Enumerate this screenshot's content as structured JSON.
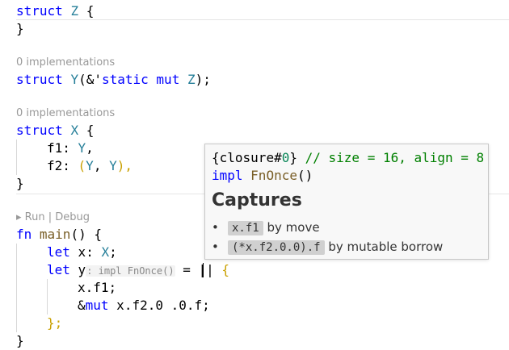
{
  "editor": {
    "lines": {
      "l1": {
        "kw": "struct",
        "name": "Z",
        "brace": "{"
      },
      "l2": {
        "brace": "}"
      },
      "lens1": "0 implementations",
      "l3": {
        "kw": "struct",
        "name": "Y",
        "pre": "(&'",
        "kw2": "static",
        "kw3": "mut",
        "ty": "Z",
        "post": ");"
      },
      "lens2": "0 implementations",
      "l4": {
        "kw": "struct",
        "name": "X",
        "brace": "{"
      },
      "l5": {
        "field": "f1",
        "ty": "Y",
        "post": ","
      },
      "l6": {
        "field": "f2",
        "open": "(",
        "ty1": "Y",
        "comma": ",",
        "ty2": "Y",
        "close": "),"
      },
      "l7": {
        "brace": "}"
      },
      "lens3": "▸ Run | Debug",
      "l8": {
        "kw": "fn",
        "name": "main",
        "post": "() {"
      },
      "l9": {
        "kw": "let",
        "var": "x",
        "colon": ":",
        "ty": "X",
        "post": ";"
      },
      "l10": {
        "kw": "let",
        "var": "y",
        "hint": ": impl FnOnce()",
        "eq": " = ",
        "bars": "||",
        "brace": "{"
      },
      "l11": {
        "text": "x.f1;"
      },
      "l12": {
        "amp": "&",
        "kw": "mut",
        "text": " x.f2.0 .0.f;"
      },
      "l13": {
        "text": "};"
      },
      "l14": {
        "brace": "}"
      }
    }
  },
  "tooltip": {
    "line1": {
      "open": "{",
      "name": "closure",
      "hash": "#",
      "num": "0",
      "close": "}",
      "comment": " // size = 16, align = 8"
    },
    "line2": {
      "kw": "impl",
      "ty": "FnOnce",
      "post": "()"
    },
    "heading": "Captures",
    "items": [
      {
        "code": "x.f1",
        "desc": "by move"
      },
      {
        "code": "(*x.f2.0.0).f",
        "desc": "by mutable borrow"
      }
    ]
  }
}
